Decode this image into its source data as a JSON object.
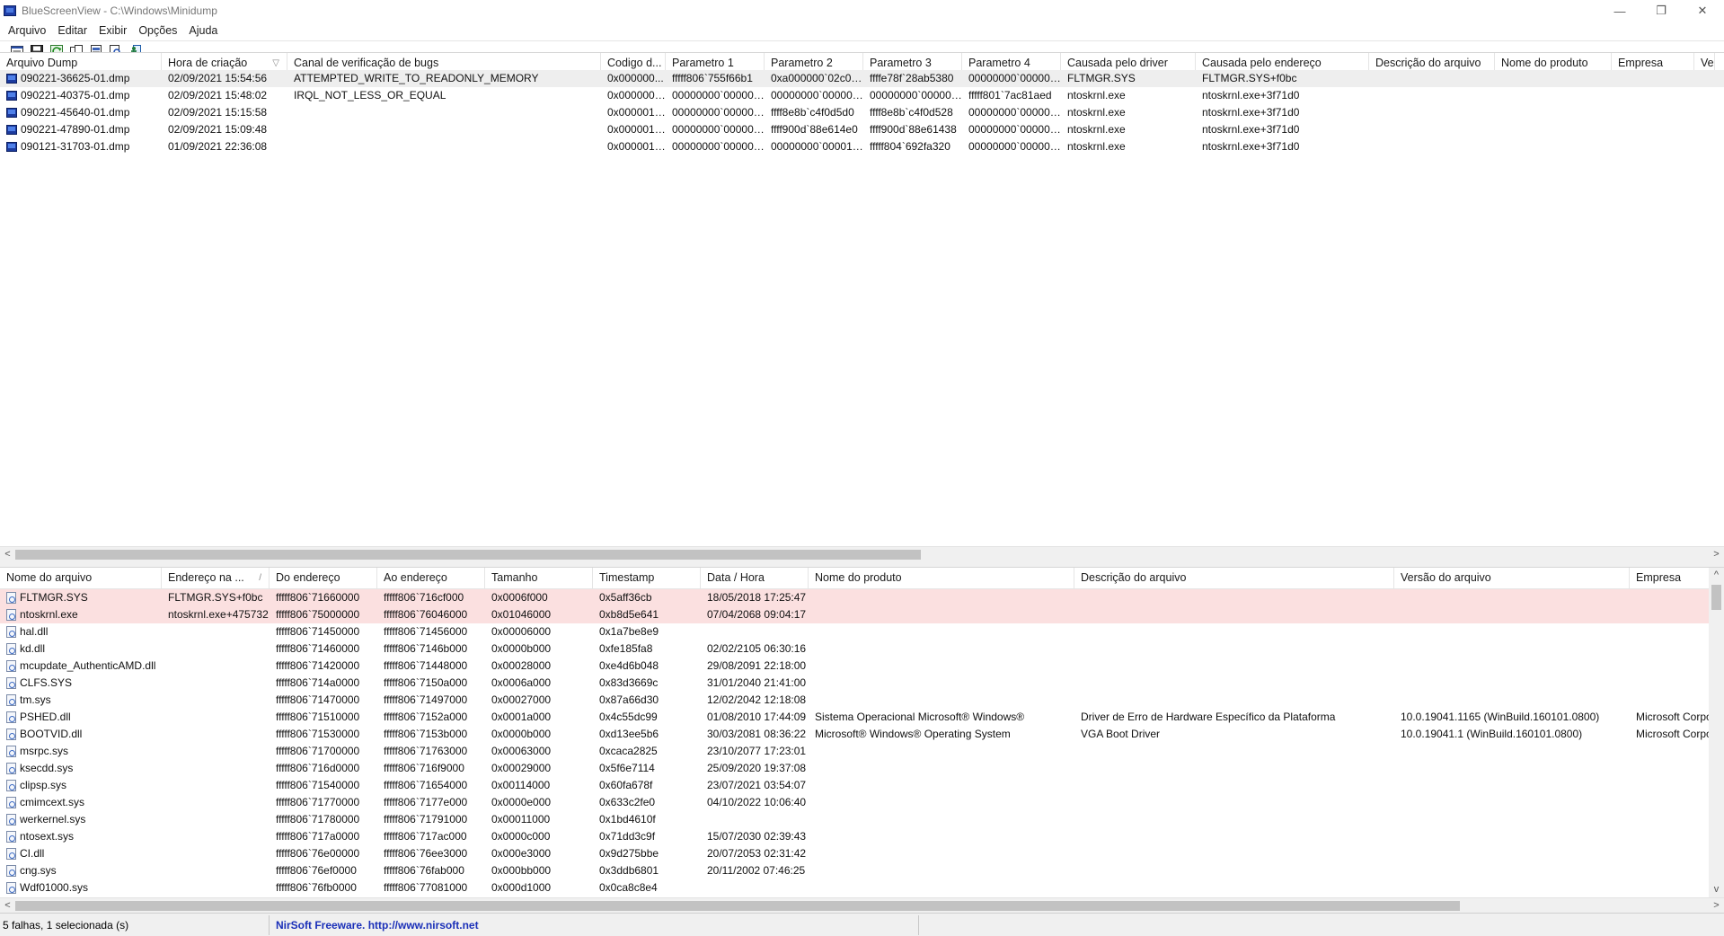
{
  "window": {
    "app_name": "BlueScreenView",
    "path": "C:\\Windows\\Minidump",
    "minimize": "—",
    "restore": "❐",
    "close": "✕"
  },
  "menu": [
    "Arquivo",
    "Editar",
    "Exibir",
    "Opções",
    "Ajuda"
  ],
  "toolbar": {
    "icons": [
      "properties-icon",
      "save-icon",
      "refresh-icon",
      "copy-icon",
      "html-report-icon",
      "find-icon",
      "exit-icon"
    ]
  },
  "dump_table": {
    "columns": [
      "Arquivo Dump",
      "Hora de criação",
      "Canal de verificação de bugs",
      "Codigo d...",
      "Parametro 1",
      "Parametro 2",
      "Parametro 3",
      "Parametro 4",
      "Causada pelo driver",
      "Causada pelo endereço",
      "Descrição do arquivo",
      "Nome do produto",
      "Empresa",
      "Versã"
    ],
    "sort_indicator": "▽",
    "rows": [
      [
        "090221-36625-01.dmp",
        "02/09/2021 15:54:56",
        "ATTEMPTED_WRITE_TO_READONLY_MEMORY",
        "0x000000...",
        "fffff806`755f66b1",
        "0xa000000`02c001...",
        "ffffe78f`28ab5380",
        "00000000`0000000f",
        "FLTMGR.SYS",
        "FLTMGR.SYS+f0bc",
        "",
        "",
        "",
        ""
      ],
      [
        "090221-40375-01.dmp",
        "02/09/2021 15:48:02",
        "IRQL_NOT_LESS_OR_EQUAL",
        "0x0000000a",
        "00000000`000000...",
        "00000000`000000...",
        "00000000`000000...",
        "fffff801`7ac81aed",
        "ntoskrnl.exe",
        "ntoskrnl.exe+3f71d0",
        "",
        "",
        "",
        ""
      ],
      [
        "090221-45640-01.dmp",
        "02/09/2021 15:15:58",
        "",
        "0x00000139",
        "00000000`000000...",
        "ffff8e8b`c4f0d5d0",
        "ffff8e8b`c4f0d528",
        "00000000`000000...",
        "ntoskrnl.exe",
        "ntoskrnl.exe+3f71d0",
        "",
        "",
        "",
        ""
      ],
      [
        "090221-47890-01.dmp",
        "02/09/2021 15:09:48",
        "",
        "0x00000139",
        "00000000`000000...",
        "ffff900d`88e614e0",
        "ffff900d`88e61438",
        "00000000`000000...",
        "ntoskrnl.exe",
        "ntoskrnl.exe+3f71d0",
        "",
        "",
        "",
        ""
      ],
      [
        "090121-31703-01.dmp",
        "01/09/2021 22:36:08",
        "",
        "0x00000133",
        "00000000`000000...",
        "00000000`00001e...",
        "fffff804`692fa320",
        "00000000`000000...",
        "ntoskrnl.exe",
        "ntoskrnl.exe+3f71d0",
        "",
        "",
        "",
        ""
      ]
    ]
  },
  "driver_table": {
    "columns": [
      "Nome do arquivo",
      "Endereço na ...",
      "Do endereço",
      "Ao endereço",
      "Tamanho",
      "Timestamp",
      "Data / Hora",
      "Nome do produto",
      "Descrição do arquivo",
      "Versão do arquivo",
      "Empresa"
    ],
    "sort_indicator": "/",
    "rows": [
      [
        "FLTMGR.SYS",
        "FLTMGR.SYS+f0bc",
        "fffff806`71660000",
        "fffff806`716cf000",
        "0x0006f000",
        "0x5aff36cb",
        "18/05/2018 17:25:47",
        "",
        "",
        "",
        ""
      ],
      [
        "ntoskrnl.exe",
        "ntoskrnl.exe+475732",
        "fffff806`75000000",
        "fffff806`76046000",
        "0x01046000",
        "0xb8d5e641",
        "07/04/2068 09:04:17",
        "",
        "",
        "",
        ""
      ],
      [
        "hal.dll",
        "",
        "fffff806`71450000",
        "fffff806`71456000",
        "0x00006000",
        "0x1a7be8e9",
        "",
        "",
        "",
        "",
        ""
      ],
      [
        "kd.dll",
        "",
        "fffff806`71460000",
        "fffff806`7146b000",
        "0x0000b000",
        "0xfe185fa8",
        "02/02/2105 06:30:16",
        "",
        "",
        "",
        ""
      ],
      [
        "mcupdate_AuthenticAMD.dll",
        "",
        "fffff806`71420000",
        "fffff806`71448000",
        "0x00028000",
        "0xe4d6b048",
        "29/08/2091 22:18:00",
        "",
        "",
        "",
        ""
      ],
      [
        "CLFS.SYS",
        "",
        "fffff806`714a0000",
        "fffff806`7150a000",
        "0x0006a000",
        "0x83d3669c",
        "31/01/2040 21:41:00",
        "",
        "",
        "",
        ""
      ],
      [
        "tm.sys",
        "",
        "fffff806`71470000",
        "fffff806`71497000",
        "0x00027000",
        "0x87a66d30",
        "12/02/2042 12:18:08",
        "",
        "",
        "",
        ""
      ],
      [
        "PSHED.dll",
        "",
        "fffff806`71510000",
        "fffff806`7152a000",
        "0x0001a000",
        "0x4c55dc99",
        "01/08/2010 17:44:09",
        "Sistema Operacional Microsoft® Windows®",
        "Driver de Erro de Hardware Específico da Plataforma",
        "10.0.19041.1165 (WinBuild.160101.0800)",
        "Microsoft Corpo"
      ],
      [
        "BOOTVID.dll",
        "",
        "fffff806`71530000",
        "fffff806`7153b000",
        "0x0000b000",
        "0xd13ee5b6",
        "30/03/2081 08:36:22",
        "Microsoft® Windows® Operating System",
        "VGA Boot Driver",
        "10.0.19041.1 (WinBuild.160101.0800)",
        "Microsoft Corpo"
      ],
      [
        "msrpc.sys",
        "",
        "fffff806`71700000",
        "fffff806`71763000",
        "0x00063000",
        "0xcaca2825",
        "23/10/2077 17:23:01",
        "",
        "",
        "",
        ""
      ],
      [
        "ksecdd.sys",
        "",
        "fffff806`716d0000",
        "fffff806`716f9000",
        "0x00029000",
        "0x5f6e7114",
        "25/09/2020 19:37:08",
        "",
        "",
        "",
        ""
      ],
      [
        "clipsp.sys",
        "",
        "fffff806`71540000",
        "fffff806`71654000",
        "0x00114000",
        "0x60fa678f",
        "23/07/2021 03:54:07",
        "",
        "",
        "",
        ""
      ],
      [
        "cmimcext.sys",
        "",
        "fffff806`71770000",
        "fffff806`7177e000",
        "0x0000e000",
        "0x633c2fe0",
        "04/10/2022 10:06:40",
        "",
        "",
        "",
        ""
      ],
      [
        "werkernel.sys",
        "",
        "fffff806`71780000",
        "fffff806`71791000",
        "0x00011000",
        "0x1bd4610f",
        "",
        "",
        "",
        "",
        ""
      ],
      [
        "ntosext.sys",
        "",
        "fffff806`717a0000",
        "fffff806`717ac000",
        "0x0000c000",
        "0x71dd3c9f",
        "15/07/2030 02:39:43",
        "",
        "",
        "",
        ""
      ],
      [
        "CI.dll",
        "",
        "fffff806`76e00000",
        "fffff806`76ee3000",
        "0x000e3000",
        "0x9d275bbe",
        "20/07/2053 02:31:42",
        "",
        "",
        "",
        ""
      ],
      [
        "cng.sys",
        "",
        "fffff806`76ef0000",
        "fffff806`76fab000",
        "0x000bb000",
        "0x3ddb6801",
        "20/11/2002 07:46:25",
        "",
        "",
        "",
        ""
      ],
      [
        "Wdf01000.sys",
        "",
        "fffff806`76fb0000",
        "fffff806`77081000",
        "0x000d1000",
        "0x0ca8c8e4",
        "",
        "",
        "",
        "",
        ""
      ]
    ]
  },
  "scroll": {
    "left_arrow": "<",
    "right_arrow": ">",
    "up_arrow": "^",
    "down_arrow": "v"
  },
  "status": {
    "selection": "5 falhas, 1 selecionada (s)",
    "credit": "NirSoft Freeware.  http://www.nirsoft.net"
  }
}
